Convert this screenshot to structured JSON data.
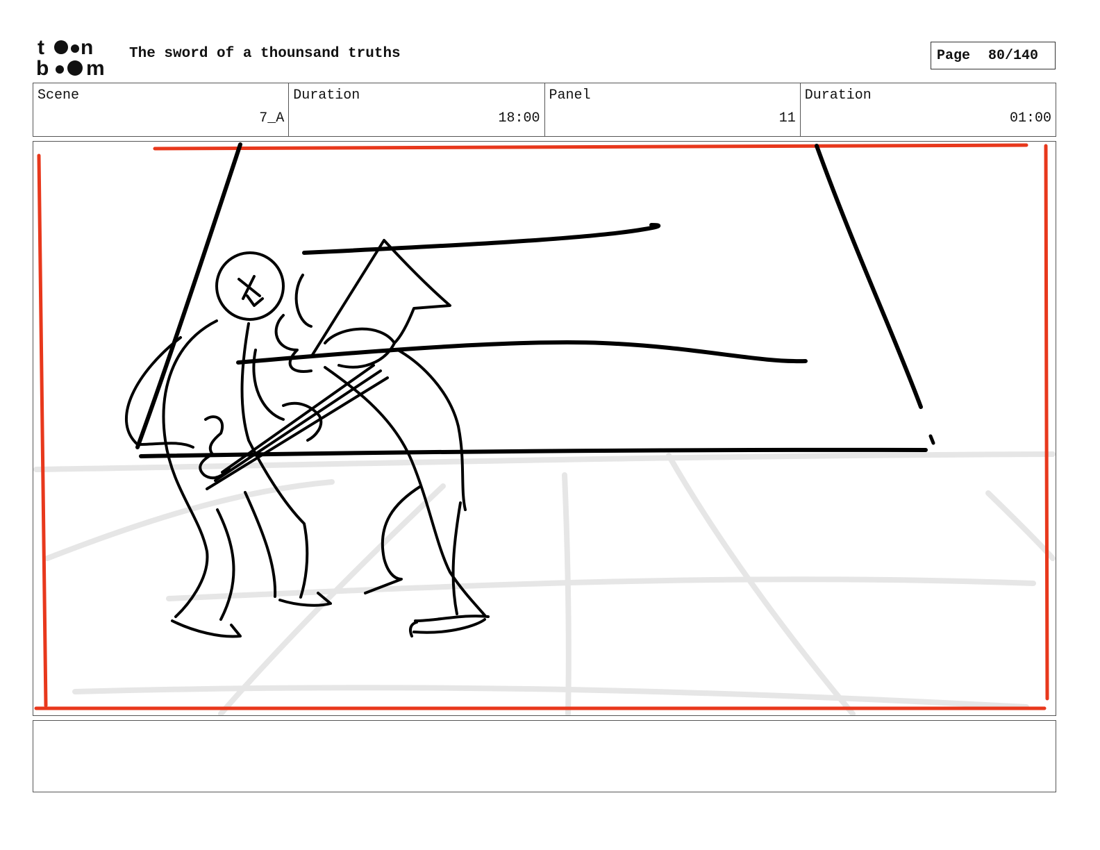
{
  "header": {
    "logo_text": "toonboom",
    "title": "The sword of a thounsand truths",
    "page_label": "Page",
    "page_value": "80/140"
  },
  "info": {
    "scene_label": "Scene",
    "scene_value": "7_A",
    "scene_duration_label": "Duration",
    "scene_duration_value": "18:00",
    "panel_label": "Panel",
    "panel_value": "11",
    "panel_duration_label": "Duration",
    "panel_duration_value": "01:00"
  },
  "colors": {
    "frame_border": "#e8381c",
    "sketch_line": "#000000",
    "guide_line": "#e6e6e6"
  },
  "notes": {
    "text": ""
  }
}
